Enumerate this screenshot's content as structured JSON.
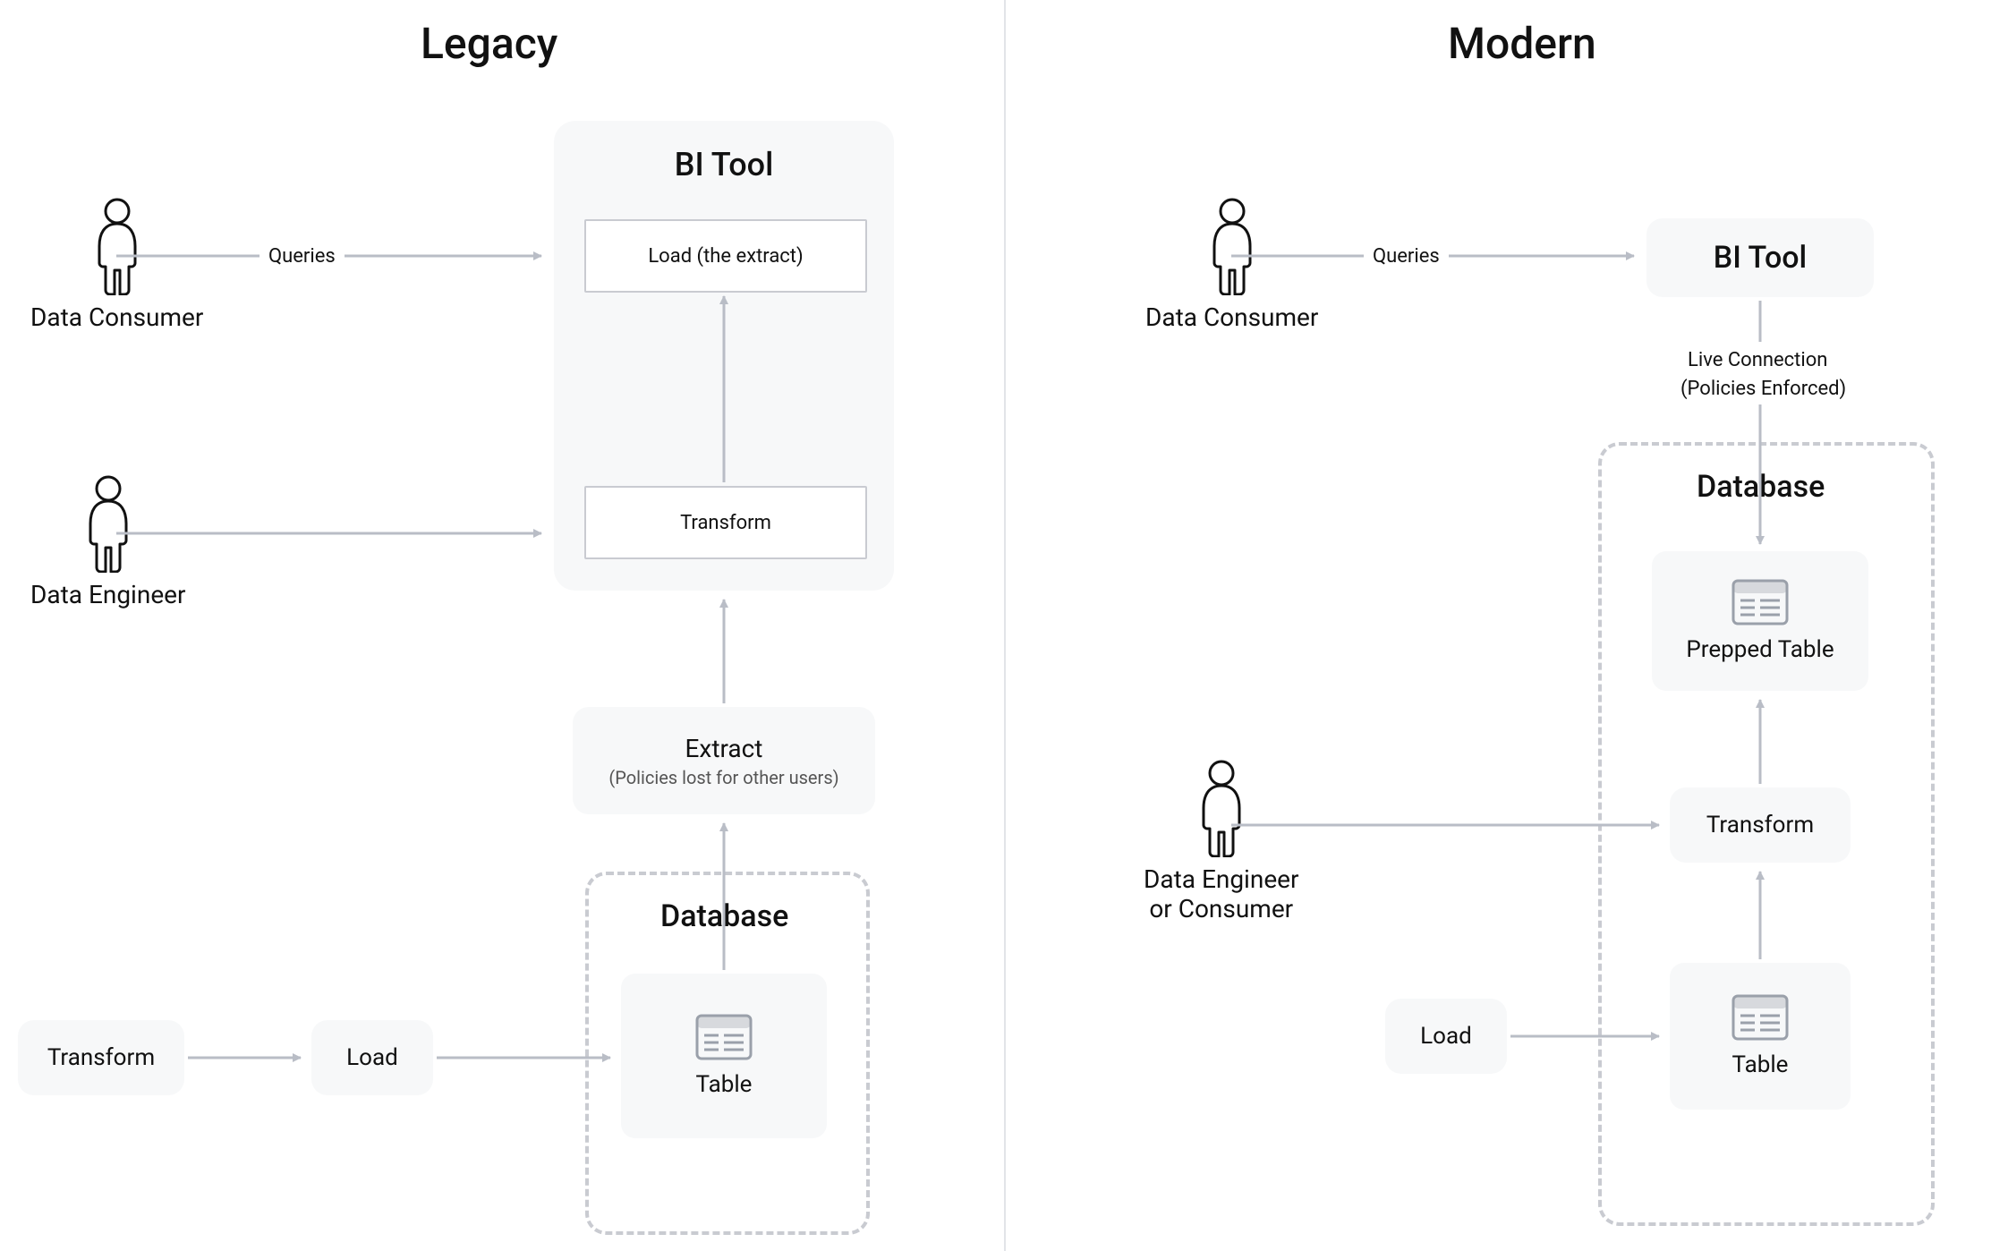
{
  "titles": {
    "left": "Legacy",
    "right": "Modern"
  },
  "legacy": {
    "consumer_label": "Data Consumer",
    "engineer_label": "Data Engineer",
    "queries_label": "Queries",
    "bi_title": "BI Tool",
    "bi_load_label": "Load (the extract)",
    "bi_transform_label": "Transform",
    "extract_title": "Extract",
    "extract_sub": "(Policies lost for other users)",
    "db_title": "Database",
    "table_label": "Table",
    "transform_box": "Transform",
    "load_box": "Load"
  },
  "modern": {
    "consumer_label": "Data Consumer",
    "queries_label": "Queries",
    "bi_title": "BI Tool",
    "live_line1": "Live Connection",
    "live_line2": "(Policies Enforced)",
    "db_title": "Database",
    "prepped_label": "Prepped Table",
    "transform_box": "Transform",
    "table_label": "Table",
    "engineer_label_l1": "Data Engineer",
    "engineer_label_l2": "or Consumer",
    "load_box": "Load"
  }
}
